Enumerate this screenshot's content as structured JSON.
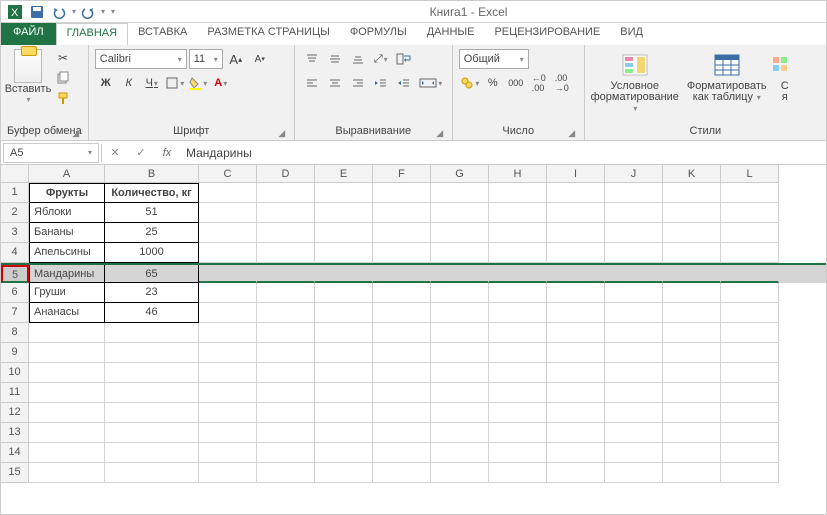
{
  "title": "Книга1 - Excel",
  "tabs": {
    "file": "ФАЙЛ",
    "home": "ГЛАВНАЯ",
    "insert": "ВСТАВКА",
    "layout": "РАЗМЕТКА СТРАНИЦЫ",
    "formulas": "ФОРМУЛЫ",
    "data": "ДАННЫЕ",
    "review": "РЕЦЕНЗИРОВАНИЕ",
    "view": "ВИД"
  },
  "ribbon": {
    "clipboard": {
      "label": "Буфер обмена",
      "paste": "Вставить"
    },
    "font": {
      "label": "Шрифт",
      "name": "Calibri",
      "size": "11",
      "bold": "Ж",
      "italic": "К",
      "under": "Ч"
    },
    "align": {
      "label": "Выравнивание"
    },
    "number": {
      "label": "Число",
      "format": "Общий",
      "pct": "%",
      "comma": "000"
    },
    "styles": {
      "label": "Стили",
      "cond": "Условное форматирование",
      "table": "Форматировать как таблицу",
      "cell_top": "С",
      "cell_bot": "я"
    }
  },
  "namebox": "A5",
  "formula": "Мандарины",
  "columns": [
    "A",
    "B",
    "C",
    "D",
    "E",
    "F",
    "G",
    "H",
    "I",
    "J",
    "K",
    "L"
  ],
  "sheet": {
    "headers": {
      "a": "Фрукты",
      "b": "Количество, кг"
    },
    "rows": [
      {
        "a": "Яблоки",
        "b": "51"
      },
      {
        "a": "Бананы",
        "b": "25"
      },
      {
        "a": "Апельсины",
        "b": "1000"
      },
      {
        "a": "Мандарины",
        "b": "65"
      },
      {
        "a": "Груши",
        "b": "23"
      },
      {
        "a": "Ананасы",
        "b": "46"
      }
    ]
  },
  "selected_row": 5,
  "chart_data": {
    "type": "table",
    "columns": [
      "Фрукты",
      "Количество, кг"
    ],
    "rows": [
      [
        "Яблоки",
        51
      ],
      [
        "Бананы",
        25
      ],
      [
        "Апельсины",
        1000
      ],
      [
        "Мандарины",
        65
      ],
      [
        "Груши",
        23
      ],
      [
        "Ананасы",
        46
      ]
    ]
  }
}
